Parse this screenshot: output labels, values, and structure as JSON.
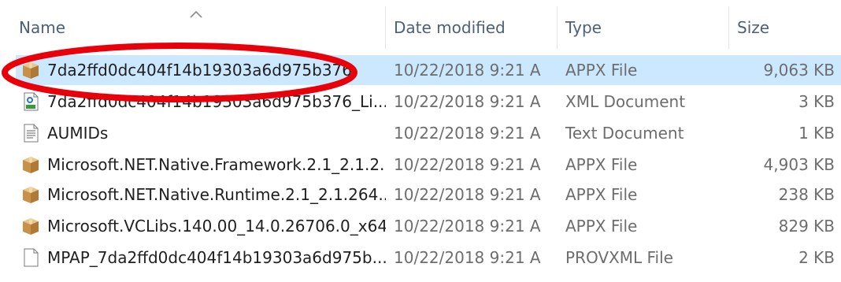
{
  "columns": {
    "name": "Name",
    "date_modified": "Date modified",
    "type": "Type",
    "size": "Size"
  },
  "rows": [
    {
      "icon": "package-icon",
      "name": "7da2ffd0dc404f14b19303a6d975b376",
      "date": "10/22/2018 9:21 A",
      "type": "APPX File",
      "size": "9,063 KB",
      "selected": true
    },
    {
      "icon": "xml-file-icon",
      "name": "7da2ffd0dc404f14b19303a6d975b376_Li...",
      "date": "10/22/2018 9:21 A",
      "type": "XML Document",
      "size": "3 KB"
    },
    {
      "icon": "text-file-icon",
      "name": "AUMIDs",
      "date": "10/22/2018 9:21 A",
      "type": "Text Document",
      "size": "1 KB"
    },
    {
      "icon": "package-icon",
      "name": "Microsoft.NET.Native.Framework.2.1_2.1.2...",
      "date": "10/22/2018 9:21 A",
      "type": "APPX File",
      "size": "4,903 KB"
    },
    {
      "icon": "package-icon",
      "name": "Microsoft.NET.Native.Runtime.2.1_2.1.264...",
      "date": "10/22/2018 9:21 A",
      "type": "APPX File",
      "size": "238 KB"
    },
    {
      "icon": "package-icon",
      "name": "Microsoft.VCLibs.140.00_14.0.26706.0_x64...",
      "date": "10/22/2018 9:21 A",
      "type": "APPX File",
      "size": "829 KB"
    },
    {
      "icon": "blank-file-icon",
      "name": "MPAP_7da2ffd0dc404f14b19303a6d975b...",
      "date": "10/22/2018 9:21 A",
      "type": "PROVXML File",
      "size": "2 KB"
    }
  ],
  "colors": {
    "selection": "#cce8ff",
    "annotation": "#e8000b",
    "header_text": "#4c607a"
  }
}
